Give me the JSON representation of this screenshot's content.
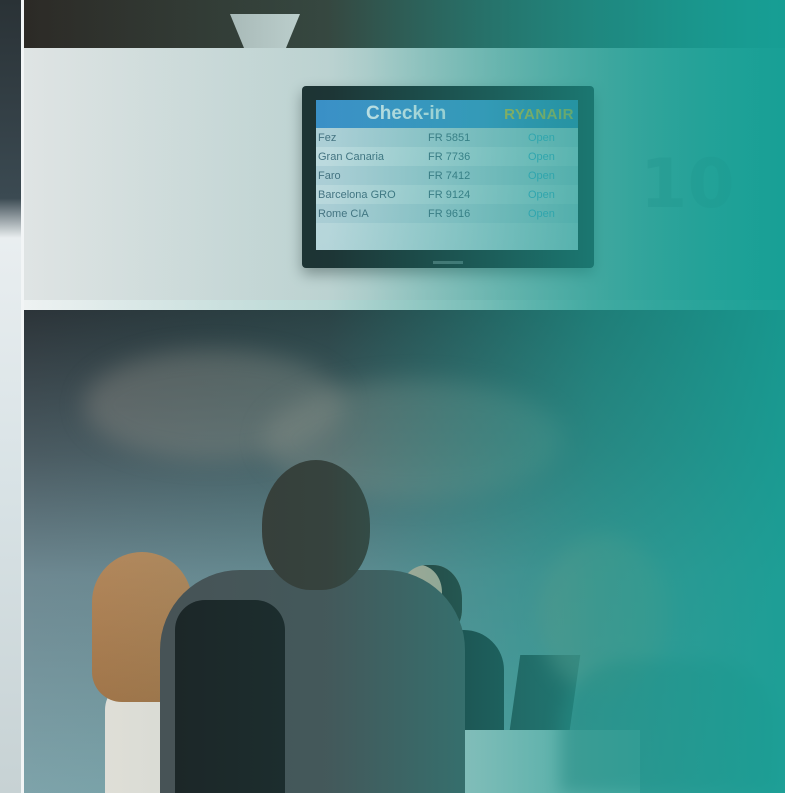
{
  "board": {
    "title": "Check-in",
    "brand": "RYANAIR",
    "counter_number": "10",
    "flights": [
      {
        "destination": "Fez",
        "flight": "FR 5851",
        "status": "Open"
      },
      {
        "destination": "Gran Canaria",
        "flight": "FR 7736",
        "status": "Open"
      },
      {
        "destination": "Faro",
        "flight": "FR 7412",
        "status": "Open"
      },
      {
        "destination": "Barcelona GRO",
        "flight": "FR 9124",
        "status": "Open"
      },
      {
        "destination": "Rome CIA",
        "flight": "FR 9616",
        "status": "Open"
      }
    ]
  },
  "colors": {
    "overlay_teal": "#1ea096",
    "board_header_blue": "#4a9ad9",
    "brand_yellow": "#f0c232"
  }
}
